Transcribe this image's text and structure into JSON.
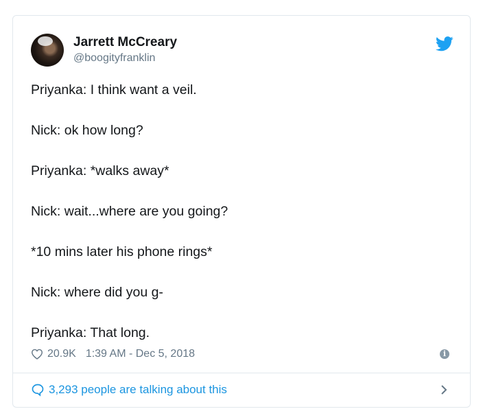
{
  "tweet": {
    "display_name": "Jarrett McCreary",
    "handle": "@boogityfranklin",
    "lines": [
      "Priyanka: I think want a veil.",
      "Nick: ok how long?",
      "Priyanka: *walks away*",
      "Nick: wait...where are you going?",
      "*10 mins later his phone rings*",
      "Nick: where did you g-",
      "Priyanka: That long."
    ],
    "likes": "20.9K",
    "timestamp": "1:39 AM - Dec 5, 2018",
    "talking": "3,293 people are talking about this"
  },
  "colors": {
    "accent": "#1b95e0",
    "twitter_blue": "#1da1f2",
    "muted": "#657786"
  },
  "icons": [
    "twitter-bird-icon",
    "heart-icon",
    "info-icon",
    "speech-bubble-icon",
    "chevron-right-icon"
  ]
}
